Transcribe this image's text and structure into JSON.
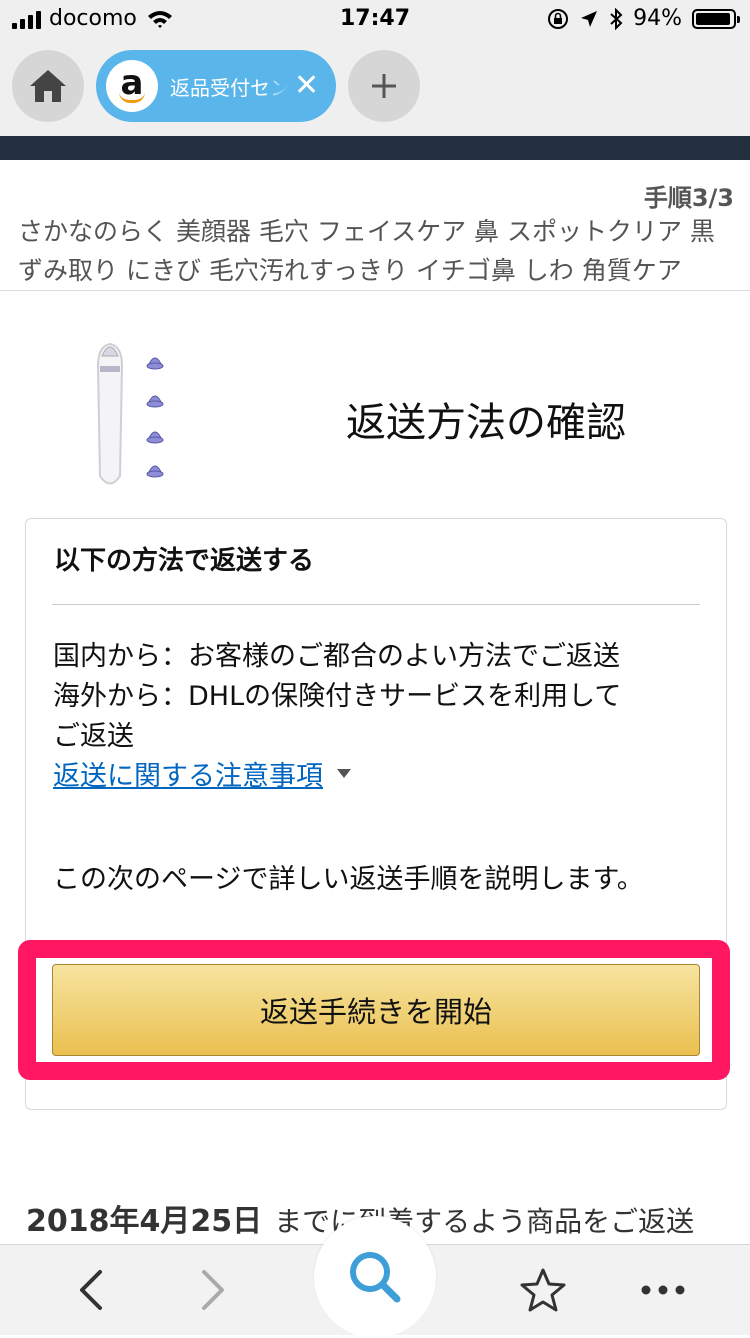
{
  "status_bar": {
    "carrier": "docomo",
    "time": "17:47",
    "battery": "94%",
    "battery_level": 0.94,
    "icons": [
      "signal-icon",
      "wifi-icon",
      "rotation-lock-icon",
      "location-icon",
      "bluetooth-icon",
      "battery-icon"
    ]
  },
  "browser_tabs": {
    "active_tab_title": "返品受付セン",
    "active_tab_color": "#5ab6ea",
    "icons": [
      "home-icon",
      "amazon-logo",
      "close-icon",
      "plus-icon"
    ]
  },
  "page": {
    "step": "手順3/3",
    "product_title": "さかなのらく 美顔器 毛穴 フェイスケア 鼻 スポットクリア 黒ずみ取り にきび 毛穴汚れすっきり イチゴ鼻 しわ 角質ケア",
    "heading": "返送方法の確認",
    "card": {
      "title": "以下の方法で返送する",
      "line1": "国内から：お客様のご都合のよい方法でご返送",
      "line2": "海外から：DHLの保険付きサービスを利用して",
      "line3": "ご返送",
      "notice_link": "返送に関する注意事項",
      "next_page_text": "この次のページで詳しい返送手順を説明します。"
    },
    "start_button": "返送手続きを開始",
    "highlight_color": "#ff1762",
    "deadline_date": "2018年4月25日",
    "deadline_text": "までに到着するよう商品をご返送"
  },
  "toolbar": {
    "icons": [
      "back-icon",
      "forward-icon",
      "search-icon",
      "star-icon",
      "more-icon"
    ]
  }
}
